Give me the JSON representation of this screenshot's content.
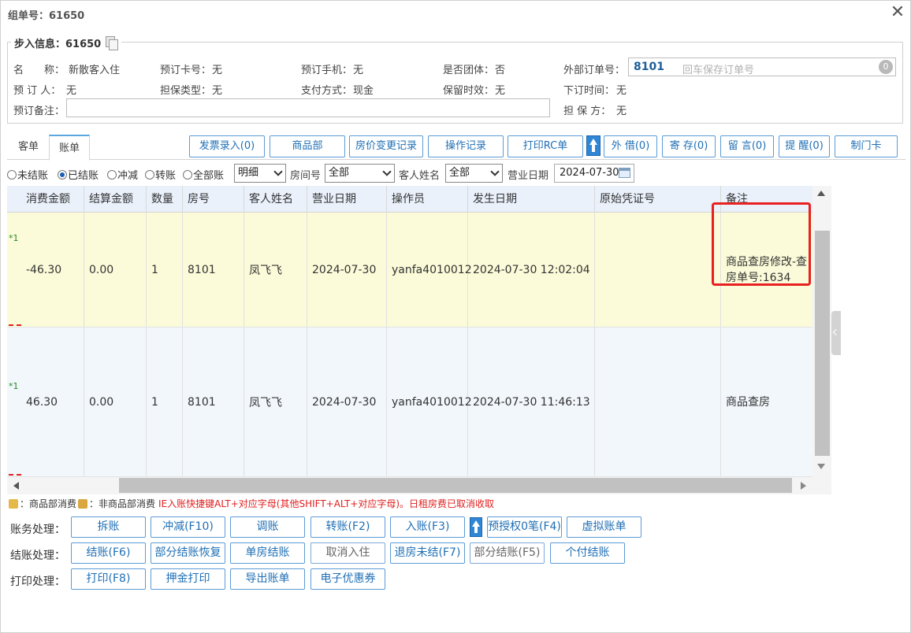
{
  "window": {
    "title": "组单号：61650"
  },
  "info": {
    "legend": "步入信息：61650",
    "name_label": "名　　称：",
    "name_value": "新散客入住",
    "card_label": "预订卡号：",
    "card_value": "无",
    "phone_label": "预订手机：",
    "phone_value": "无",
    "group_label": "是否团体：",
    "group_value": "否",
    "ext_label": "外部订单号：",
    "ext_value": "8101",
    "ext_placeholder": "回车保存订单号",
    "ext_clear": "0",
    "booker_label": "预 订 人：",
    "booker_value": "无",
    "guarantee_type_label": "担保类型：",
    "guarantee_type_value": "无",
    "pay_label": "支付方式：",
    "pay_value": "现金",
    "hold_label": "保留时效：",
    "hold_value": "无",
    "order_time_label": "下订时间：",
    "order_time_value": "无",
    "remark_label": "预订备注：",
    "remark_value": "",
    "guarantor_label": "担 保 方：",
    "guarantor_value": "无"
  },
  "tabs": [
    "客单",
    "账单"
  ],
  "toolbar": [
    "发票录入(0)",
    "商品部",
    "房价变更记录",
    "操作记录",
    "打印RC单",
    "外 借(0)",
    "寄 存(0)",
    "留 言(0)",
    "提 醒(0)",
    "制门卡"
  ],
  "filters": {
    "radios": [
      "未结账",
      "已结账",
      "冲减",
      "转账",
      "全部账"
    ],
    "selected_radio": "已结账",
    "detail_value": "明细",
    "room_label": "房间号",
    "room_value": "全部",
    "guest_label": "客人姓名",
    "guest_value": "全部",
    "date_label": "营业日期",
    "date_value": "2024-07-30"
  },
  "table": {
    "columns": [
      "消费金额",
      "结算金额",
      "数量",
      "房号",
      "客人姓名",
      "营业日期",
      "操作员",
      "发生日期",
      "原始凭证号",
      "备注"
    ],
    "rows": [
      {
        "marker": "*1",
        "amount": "-46.30",
        "settle": "0.00",
        "qty": "1",
        "room": "8101",
        "guest": "凤飞飞",
        "biz_date": "2024-07-30",
        "operator": "yanfa4010012",
        "occur": "2024-07-30 12:02:04",
        "voucher": "",
        "note": "商品查房修改-查房单号:1634"
      },
      {
        "marker": "*1",
        "amount": "46.30",
        "settle": "0.00",
        "qty": "1",
        "room": "8101",
        "guest": "凤飞飞",
        "biz_date": "2024-07-30",
        "operator": "yanfa4010012",
        "occur": "2024-07-30 11:46:13",
        "voucher": "",
        "note": "商品查房"
      }
    ]
  },
  "legend_text": {
    "goods": "：商品部消费",
    "non_goods": "：非商品部消费",
    "warning": "IE入账快捷键ALT+对应字母(其他SHIFT+ALT+对应字母)。日租房费已取消收取"
  },
  "actions": {
    "account_label": "账务处理：",
    "account": [
      "拆账",
      "冲减(F10)",
      "调账",
      "转账(F2)",
      "入账(F3)",
      "预授权0笔(F4)",
      "虚拟账单"
    ],
    "checkout_label": "结账处理：",
    "checkout": [
      "结账(F6)",
      "部分结账恢复",
      "单房结账",
      "取消入住",
      "退房未结(F7)",
      "部分结账(F5)",
      "个付结账"
    ],
    "print_label": "打印处理：",
    "print": [
      "打印(F8)",
      "押金打印",
      "导出账单",
      "电子优惠券"
    ]
  },
  "colors": {
    "accent": "#1f6fb5",
    "highlight_row": "#fbfbd9",
    "warning": "#e02020"
  }
}
